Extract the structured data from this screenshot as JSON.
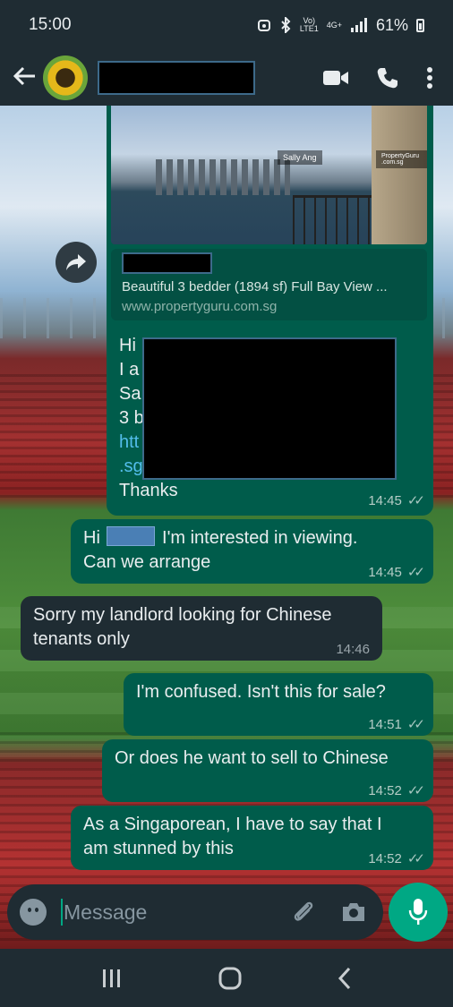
{
  "status_bar": {
    "time": "15:00",
    "network_top": "Vo)",
    "network_bottom": "LTE1",
    "signal_type": "4G+",
    "battery": "61%"
  },
  "header": {
    "contact_name": "",
    "icons": [
      "back-arrow-icon",
      "video-call-icon",
      "phone-icon",
      "more-vert-icon"
    ]
  },
  "link_preview": {
    "watermark_left": "Sally Ang",
    "watermark_right": "PropertyGuru .com.sg",
    "title": "Beautiful 3 bedder (1894 sf) Full Bay View ...",
    "site": "www.propertyguru.com.sg",
    "message_visible_lines": [
      "Hi",
      "I a",
      "Sa",
      "3 b",
      "htt",
      ".sg",
      "Thanks"
    ],
    "time": "14:45"
  },
  "messages": [
    {
      "direction": "out",
      "text_before": "Hi",
      "text_after": "I'm interested in viewing.",
      "text_line2": "Can we arrange",
      "time": "14:45"
    },
    {
      "direction": "in",
      "line1": "Sorry my landlord looking for Chinese",
      "line2": "tenants only",
      "time": "14:46"
    },
    {
      "direction": "out",
      "line1": "I'm confused. Isn't this for sale?",
      "time": "14:51"
    },
    {
      "direction": "out",
      "line1": "Or does he want to sell to Chinese",
      "time": "14:52"
    },
    {
      "direction": "out",
      "line1": "As a Singaporean, I have to say that I",
      "line2": "am stunned by this",
      "time": "14:52"
    }
  ],
  "input": {
    "placeholder": "Message"
  },
  "colors": {
    "outgoing_bubble": "#005c4b",
    "incoming_bubble": "#1f2c33",
    "accent": "#00a884",
    "link": "#53bdeb"
  }
}
